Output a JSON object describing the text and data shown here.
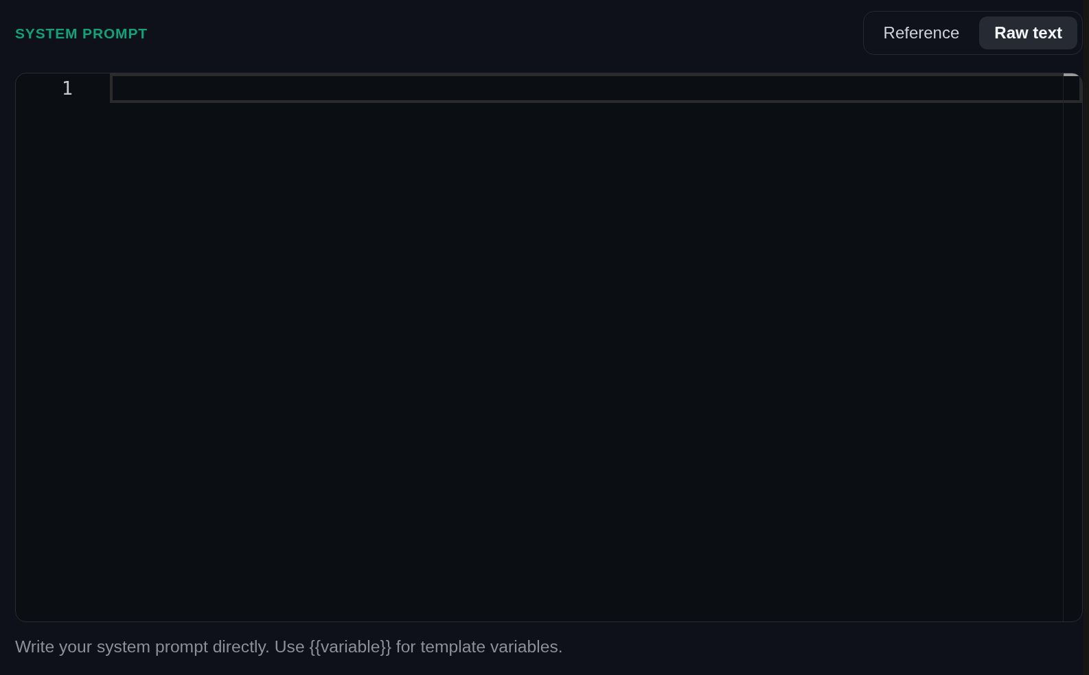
{
  "section_title": "SYSTEM PROMPT",
  "mode_toggle": [
    {
      "label": "Reference",
      "selected": false
    },
    {
      "label": "Raw text",
      "selected": true
    }
  ],
  "editor": {
    "lines": [
      {
        "number": "1",
        "current": true
      }
    ]
  },
  "helper_text": "Write your system prompt directly. Use {{variable}} for template variables."
}
